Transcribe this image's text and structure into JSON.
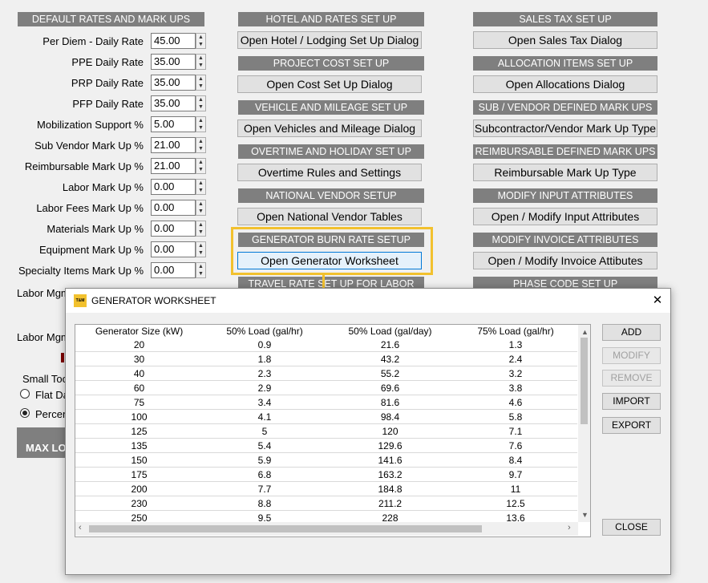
{
  "col1": {
    "header": "DEFAULT RATES AND MARK UPS",
    "rows": [
      {
        "label": "Per Diem - Daily Rate",
        "value": "45.00"
      },
      {
        "label": "PPE Daily Rate",
        "value": "35.00"
      },
      {
        "label": "PRP Daily Rate",
        "value": "35.00"
      },
      {
        "label": "PFP Daily Rate",
        "value": "35.00"
      },
      {
        "label": "Mobilization Support %",
        "value": "5.00"
      },
      {
        "label": "Sub Vendor Mark Up %",
        "value": "21.00"
      },
      {
        "label": "Reimbursable Mark Up %",
        "value": "21.00"
      },
      {
        "label": "Labor Mark Up  %",
        "value": "0.00"
      },
      {
        "label": "Labor Fees Mark Up  %",
        "value": "0.00"
      },
      {
        "label": "Materials Mark Up  %",
        "value": "0.00"
      },
      {
        "label": "Equipment Mark Up  %",
        "value": "0.00"
      },
      {
        "label": "Specialty Items Mark Up  %",
        "value": "0.00"
      }
    ],
    "partial": {
      "labor_mgmt_1": "Labor Mgm",
      "labor_mgmt_2": "Labor Mgm",
      "small_tools": "Small Too",
      "flat": "Flat Da",
      "percent": "Percen",
      "max": "MAX LO"
    }
  },
  "col2": [
    {
      "header": "HOTEL AND RATES SET UP",
      "button": "Open Hotel / Lodging Set Up Dialog"
    },
    {
      "header": "PROJECT COST SET UP",
      "button": "Open Cost Set Up Dialog"
    },
    {
      "header": "VEHICLE AND MILEAGE SET UP",
      "button": "Open Vehicles and Mileage Dialog"
    },
    {
      "header": "OVERTIME AND HOLIDAY SET UP",
      "button": "Overtime Rules and Settings"
    },
    {
      "header": "NATIONAL VENDOR SETUP",
      "button": "Open National Vendor Tables"
    },
    {
      "header": "GENERATOR BURN RATE SETUP",
      "button": "Open Generator Worksheet"
    },
    {
      "header": "TRAVEL RATE SET UP FOR LABOR"
    }
  ],
  "col3": [
    {
      "header": "SALES TAX SET UP",
      "button": "Open Sales Tax Dialog"
    },
    {
      "header": "ALLOCATION ITEMS SET UP",
      "button": "Open Allocations Dialog"
    },
    {
      "header": "SUB / VENDOR DEFINED MARK UPS",
      "button": "Subcontractor/Vendor Mark Up Type"
    },
    {
      "header": "REIMBURSABLE DEFINED MARK UPS",
      "button": "Reimbursable Mark Up Type"
    },
    {
      "header": "MODIFY INPUT ATTRIBUTES",
      "button": "Open / Modify Input Attributes"
    },
    {
      "header": "MODIFY INVOICE ATTRIBUTES",
      "button": "Open / Modify  Invoice Attibutes"
    },
    {
      "header": "PHASE CODE SET UP"
    }
  ],
  "dialog": {
    "logo": "T&M",
    "title": "GENERATOR WORKSHEET",
    "close": "✕",
    "columns": [
      "Generator Size (kW)",
      "50% Load (gal/hr)",
      "50% Load (gal/day)",
      "75% Load (gal/hr)"
    ],
    "rows": [
      [
        "20",
        "0.9",
        "21.6",
        "1.3"
      ],
      [
        "30",
        "1.8",
        "43.2",
        "2.4"
      ],
      [
        "40",
        "2.3",
        "55.2",
        "3.2"
      ],
      [
        "60",
        "2.9",
        "69.6",
        "3.8"
      ],
      [
        "75",
        "3.4",
        "81.6",
        "4.6"
      ],
      [
        "100",
        "4.1",
        "98.4",
        "5.8"
      ],
      [
        "125",
        "5",
        "120",
        "7.1"
      ],
      [
        "135",
        "5.4",
        "129.6",
        "7.6"
      ],
      [
        "150",
        "5.9",
        "141.6",
        "8.4"
      ],
      [
        "175",
        "6.8",
        "163.2",
        "9.7"
      ],
      [
        "200",
        "7.7",
        "184.8",
        "11"
      ],
      [
        "230",
        "8.8",
        "211.2",
        "12.5"
      ],
      [
        "250",
        "9.5",
        "228",
        "13.6"
      ]
    ],
    "buttons": {
      "add": "ADD",
      "modify": "MODIFY",
      "remove": "REMOVE",
      "import": "IMPORT",
      "export": "EXPORT",
      "close": "CLOSE"
    }
  },
  "colors": {
    "header_bg": "#7f7f7f",
    "highlight": "#f2c12e",
    "button_focus": "#0078d7"
  }
}
